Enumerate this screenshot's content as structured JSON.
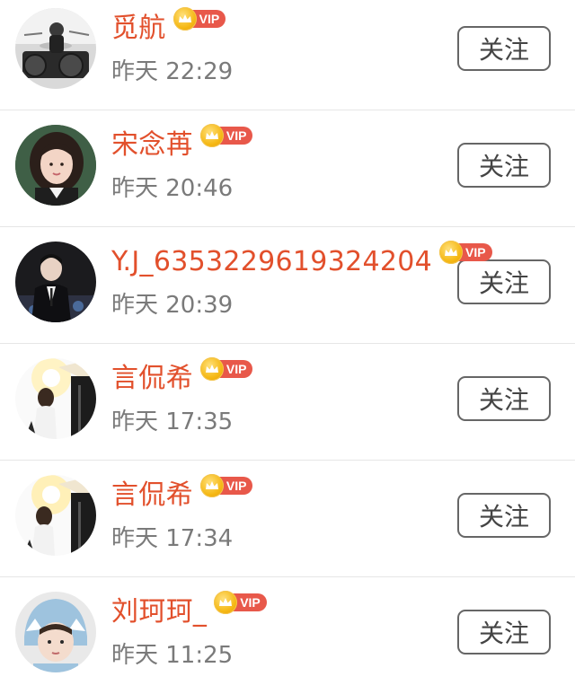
{
  "vip_label": "VIP",
  "colors": {
    "name": "#e2502c",
    "time": "#7a7a7a",
    "vip_tag": "#e8584a",
    "vip_crown": "#f5b814",
    "button_border": "#666666",
    "divider": "#e6e6e6"
  },
  "follows": [
    {
      "name": "觅航",
      "time": "昨天 22:29",
      "follow_label": "关注",
      "avatar": "drummer-avatar"
    },
    {
      "name": "宋念苒",
      "time": "昨天 20:46",
      "follow_label": "关注",
      "avatar": "girl-portrait-avatar"
    },
    {
      "name": "Y.J_6353229619324204",
      "time": "昨天 20:39",
      "follow_label": "关注",
      "avatar": "man-in-suit-avatar"
    },
    {
      "name": "言侃希",
      "time": "昨天 17:35",
      "follow_label": "关注",
      "avatar": "sunlit-figure-avatar"
    },
    {
      "name": "言侃希",
      "time": "昨天 17:34",
      "follow_label": "关注",
      "avatar": "sunlit-figure-avatar"
    },
    {
      "name": "刘珂珂_",
      "time": "昨天 11:25",
      "follow_label": "关注",
      "avatar": "child-shark-hat-avatar"
    }
  ]
}
